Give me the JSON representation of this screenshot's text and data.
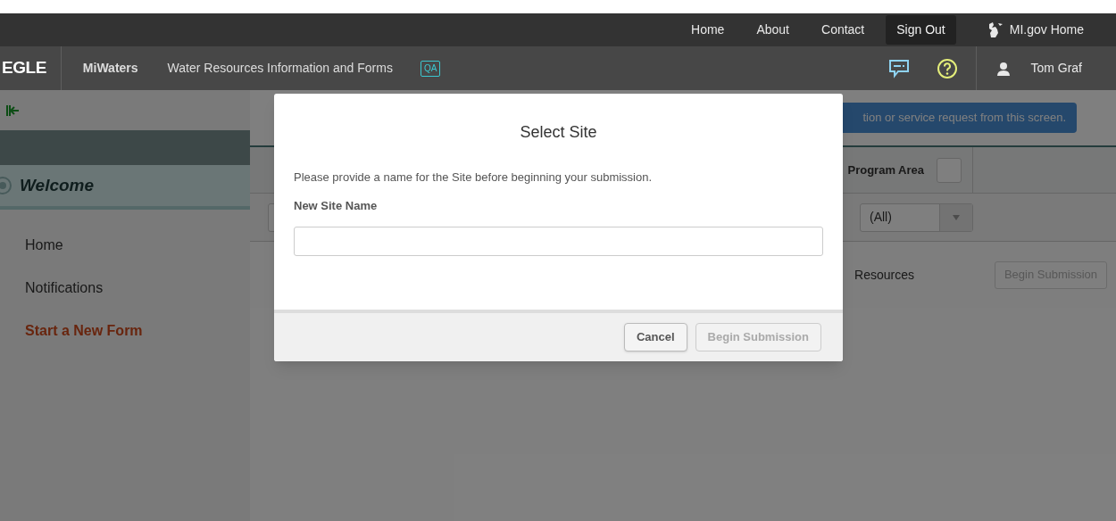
{
  "top_nav": {
    "links": [
      {
        "label": "Home",
        "selected": false
      },
      {
        "label": "About",
        "selected": false
      },
      {
        "label": "Contact",
        "selected": false
      },
      {
        "label": "Sign Out",
        "selected": true
      }
    ],
    "state_link": "MI.gov Home"
  },
  "header": {
    "logo": "EGLE",
    "app_name": "MiWaters",
    "subtitle": "Water Resources Information and Forms",
    "env_badge": "QA",
    "user": "Tom Graf"
  },
  "sidebar": {
    "section": "Welcome",
    "items": [
      {
        "label": "Home",
        "selected": false
      },
      {
        "label": "Notifications",
        "selected": false
      },
      {
        "label": "Start a New Form",
        "selected": true
      }
    ]
  },
  "background": {
    "banner": "tion or service request from this screen.",
    "column_2": "Program Area",
    "filter_2": "(All)",
    "row_resources": "Resources",
    "row_button": "Begin Submission"
  },
  "dialog": {
    "title": "Select Site",
    "message": "Please provide a name for the Site before beginning your submission.",
    "field_label": "New Site Name",
    "buttons": [
      {
        "label": "Cancel",
        "disabled": false
      },
      {
        "label": "Begin Submission",
        "disabled": true
      }
    ]
  }
}
